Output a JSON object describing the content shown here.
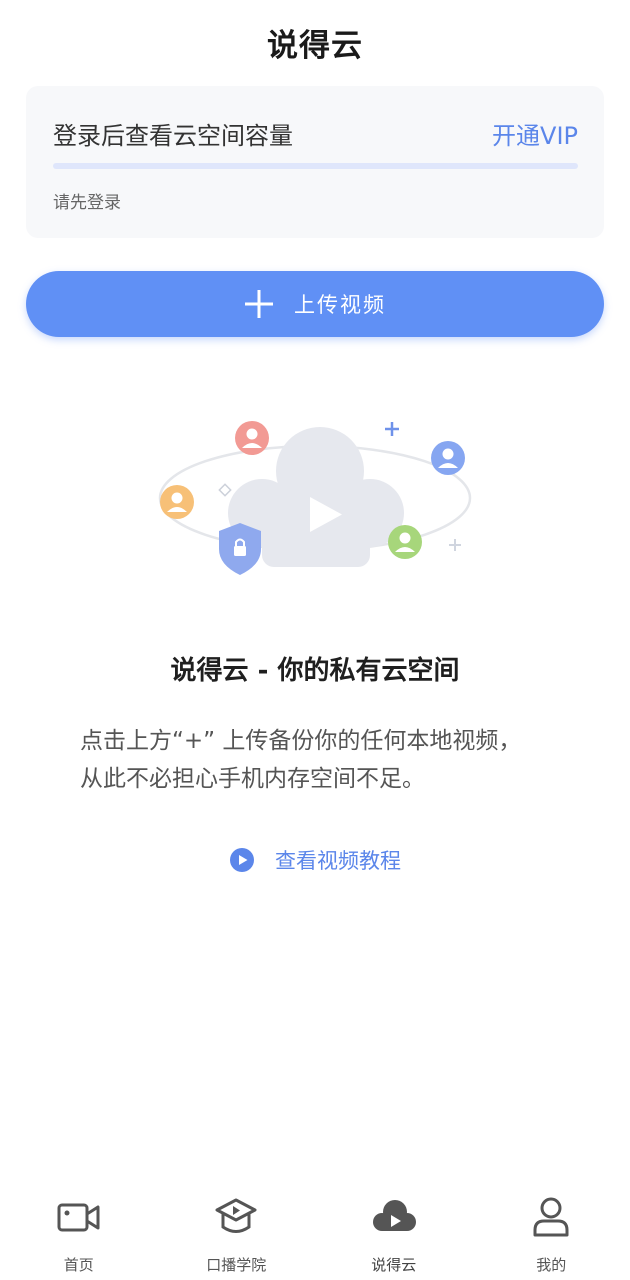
{
  "header": {
    "title": "说得云"
  },
  "storage": {
    "text": "登录后查看云空间容量",
    "vip_label": "开通VIP",
    "used_fraction": 0,
    "login_hint": "请先登录"
  },
  "upload": {
    "label": "上传视频"
  },
  "hero": {
    "title": "说得云 - 你的私有云空间",
    "desc_line1": "点击上方“+” 上传备份你的任何本地视频，",
    "desc_line2": "从此不必担心手机内存空间不足。",
    "tutorial_label": "查看视频教程"
  },
  "tabs": [
    {
      "label": "首页",
      "icon": "video-camera-icon"
    },
    {
      "label": "口播学院",
      "icon": "graduation-cap-icon"
    },
    {
      "label": "说得云",
      "icon": "cloud-play-icon",
      "active": true
    },
    {
      "label": "我的",
      "icon": "user-icon"
    }
  ],
  "colors": {
    "accent": "#5b86ea",
    "button": "#6090f5"
  }
}
